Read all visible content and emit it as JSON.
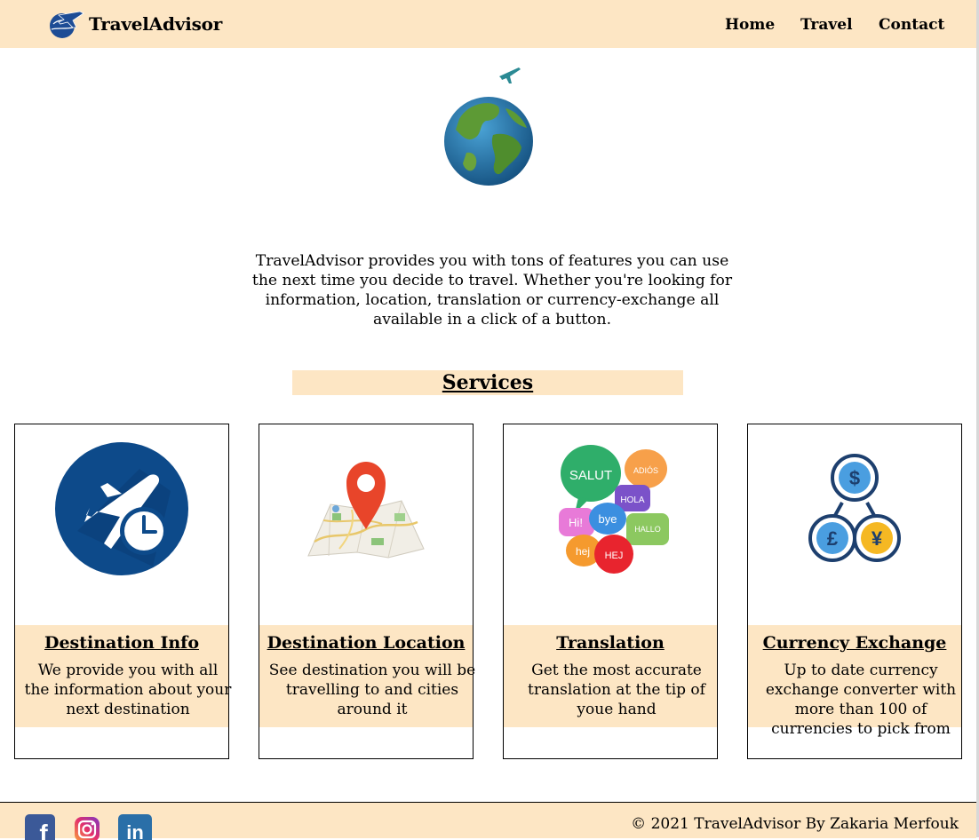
{
  "header": {
    "brand": "TravelAdvisor",
    "logo_icon": "airplane-globe-logo-icon",
    "nav": [
      {
        "label": "Home"
      },
      {
        "label": "Travel"
      },
      {
        "label": "Contact"
      }
    ]
  },
  "hero": {
    "plane_icon": "small-airplane-icon",
    "globe_icon": "globe-icon",
    "intro": "TravelAdvisor provides you with tons of features you can use the next time you decide to travel. Whether you're looking for information, location, translation or currency-exchange all available in a click of a button."
  },
  "services": {
    "title": "Services",
    "cards": [
      {
        "title": "Destination Info",
        "text": "We provide you with all the information about your next destination",
        "icon": "airplane-clock-icon"
      },
      {
        "title": "Destination Location",
        "text": "See destination you will be travelling to and cities around it",
        "icon": "map-pin-icon"
      },
      {
        "title": "Translation",
        "text": "Get the most accurate translation at the tip of youe hand",
        "icon": "speech-bubbles-icon"
      },
      {
        "title": "Currency Exchange",
        "text": "Up to date currency exchange converter with more than 100 of currencies to pick from",
        "icon": "currency-exchange-icon"
      }
    ],
    "speech_words": [
      "SALUT",
      "ADIÓS",
      "HOLA",
      "Hi!",
      "bye",
      "HALLO",
      "hej",
      "HEJ"
    ]
  },
  "footer": {
    "social": [
      {
        "name": "facebook-icon",
        "glyph": "f"
      },
      {
        "name": "instagram-icon",
        "glyph": ""
      },
      {
        "name": "linkedin-icon",
        "glyph": "in"
      }
    ],
    "copyright": "© 2021 TravelAdvisor By Zakaria Merfouk"
  },
  "colors": {
    "accent_bg": "#fde6c4",
    "facebook": "#3b5998",
    "linkedin": "#2a6fa8",
    "plane_blue": "#0d4a8a"
  }
}
